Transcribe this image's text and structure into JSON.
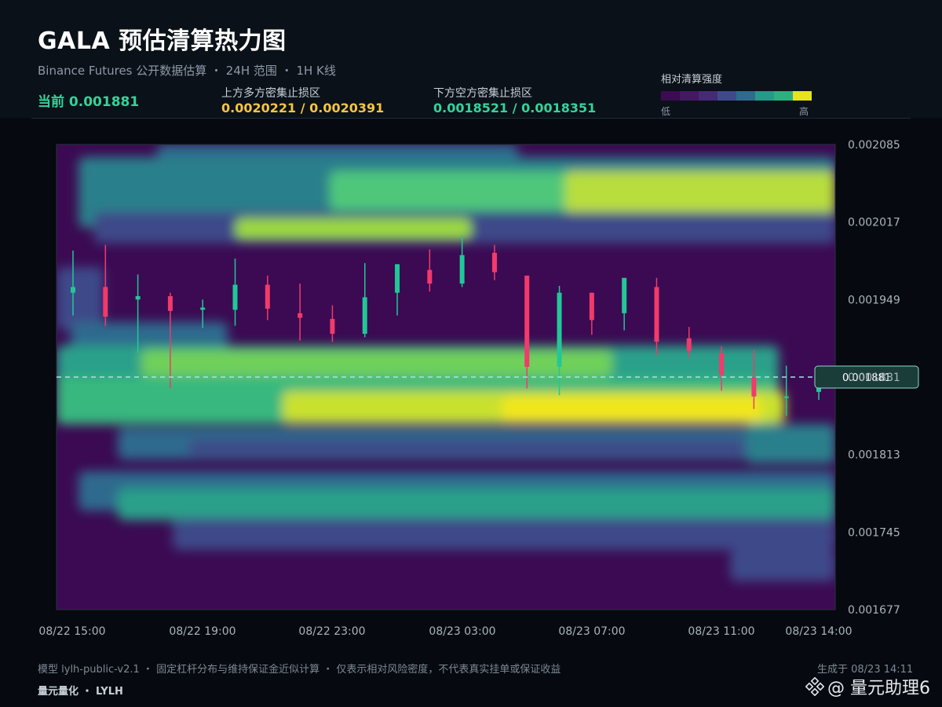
{
  "header": {
    "title": "GALA 预估清算热力图",
    "subtitle": "Binance Futures 公开数据估算 ・ 24H 范围 ・ 1H K线",
    "current_label": "当前 0.001881",
    "upper_zone_label": "上方多方密集止损区",
    "upper_zone_value": "0.0020221 / 0.0020391",
    "lower_zone_label": "下方空方密集止损区",
    "lower_zone_value": "0.0018521 / 0.0018351"
  },
  "legend": {
    "title": "相对清算强度",
    "low": "低",
    "high": "高",
    "colors": [
      "#3d0b52",
      "#451862",
      "#472a74",
      "#3e4a89",
      "#2f6b8e",
      "#239b89",
      "#2bb07f",
      "#e7e419"
    ]
  },
  "colors": {
    "up": "#22c797",
    "down": "#f23a6b",
    "current_line": "#a9e1e6",
    "current_tag_bg": "#1a3d3a",
    "upper_zone_text": "#f5c542",
    "lower_zone_text": "#36d39a"
  },
  "chart_data": {
    "type": "heatmap",
    "overlay": "candlestick",
    "y_ticks": [
      "0.002085",
      "0.002017",
      "0.001949",
      "0.001881",
      "0.001813",
      "0.001745",
      "0.001677"
    ],
    "ylim": [
      0.001677,
      0.002085
    ],
    "x_ticks": [
      "08/22 15:00",
      "08/22 19:00",
      "08/22 23:00",
      "08/23 03:00",
      "08/23 07:00",
      "08/23 11:00",
      "08/23 14:00"
    ],
    "current_price": 0.001881,
    "current_price_label": "0.001881",
    "candles": [
      {
        "o": 0.001955,
        "c": 0.00196,
        "h": 0.001992,
        "l": 0.001935
      },
      {
        "o": 0.00196,
        "c": 0.001934,
        "h": 0.001997,
        "l": 0.001926
      },
      {
        "o": 0.001949,
        "c": 0.001952,
        "h": 0.001971,
        "l": 0.001902
      },
      {
        "o": 0.001952,
        "c": 0.001939,
        "h": 0.001955,
        "l": 0.001871
      },
      {
        "o": 0.00194,
        "c": 0.001942,
        "h": 0.001949,
        "l": 0.001924
      },
      {
        "o": 0.00194,
        "c": 0.001962,
        "h": 0.001985,
        "l": 0.001926
      },
      {
        "o": 0.001962,
        "c": 0.001941,
        "h": 0.00197,
        "l": 0.001931
      },
      {
        "o": 0.001937,
        "c": 0.001933,
        "h": 0.001963,
        "l": 0.001913
      },
      {
        "o": 0.001932,
        "c": 0.001919,
        "h": 0.001944,
        "l": 0.001912
      },
      {
        "o": 0.001919,
        "c": 0.001951,
        "h": 0.001981,
        "l": 0.001916
      },
      {
        "o": 0.001955,
        "c": 0.00198,
        "h": 0.00198,
        "l": 0.001935
      },
      {
        "o": 0.001975,
        "c": 0.001963,
        "h": 0.001993,
        "l": 0.001956
      },
      {
        "o": 0.001963,
        "c": 0.001988,
        "h": 0.002005,
        "l": 0.00196
      },
      {
        "o": 0.00199,
        "c": 0.001973,
        "h": 0.001997,
        "l": 0.001966
      },
      {
        "o": 0.00197,
        "c": 0.00189,
        "h": 0.00197,
        "l": 0.001871
      },
      {
        "o": 0.00189,
        "c": 0.001955,
        "h": 0.001961,
        "l": 0.001865
      },
      {
        "o": 0.001955,
        "c": 0.001931,
        "h": 0.001955,
        "l": 0.001918
      },
      {
        "o": 0.001937,
        "c": 0.001968,
        "h": 0.001968,
        "l": 0.001922
      },
      {
        "o": 0.00196,
        "c": 0.001912,
        "h": 0.001968,
        "l": 0.0019
      },
      {
        "o": 0.001915,
        "c": 0.001904,
        "h": 0.001925,
        "l": 0.001898
      },
      {
        "o": 0.001902,
        "c": 0.001883,
        "h": 0.001908,
        "l": 0.001869
      },
      {
        "o": 0.001881,
        "c": 0.001864,
        "h": 0.001905,
        "l": 0.001853
      },
      {
        "o": 0.001863,
        "c": 0.001864,
        "h": 0.001891,
        "l": 0.001847
      },
      {
        "o": 0.001868,
        "c": 0.001875,
        "h": 0.001881,
        "l": 0.001861
      }
    ]
  },
  "footer": {
    "note": "模型 lylh-public-v2.1 ・ 固定杠杆分布与维持保证金近似计算 ・ 仅表示相对风险密度，不代表真实挂单或保证收益",
    "brand": "量元量化 ・ LYLH",
    "generated": "生成于 08/23 14:11",
    "watermark": "@ 量元助理6"
  }
}
